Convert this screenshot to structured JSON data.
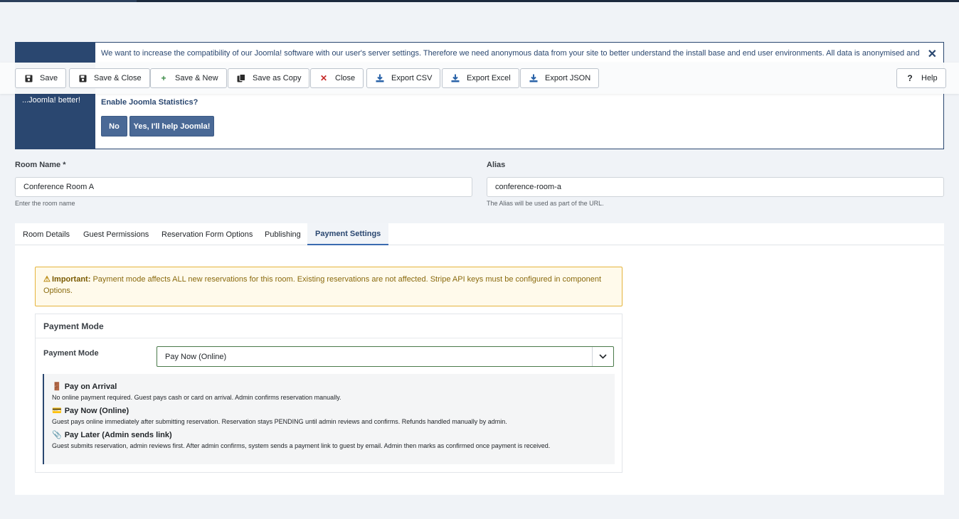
{
  "stats": {
    "side_text": "...Joomla! better!",
    "message": "We want to increase the compatibility of our Joomla! software with our user's server settings. Therefore we need anonymous data from your site to better understand the install base and end user environments. All data is anonymised and only",
    "question": "Enable Joomla Statistics?",
    "no_label": "No",
    "yes_label": "Yes, I'll help Joomla!"
  },
  "toolbar": {
    "save": "Save",
    "save_close": "Save & Close",
    "save_new": "Save & New",
    "save_copy": "Save as Copy",
    "close": "Close",
    "export_csv": "Export CSV",
    "export_excel": "Export Excel",
    "export_json": "Export JSON",
    "help": "Help"
  },
  "form": {
    "room_name_label": "Room Name *",
    "room_name_value": "Conference Room A",
    "room_name_help": "Enter the room name",
    "alias_label": "Alias",
    "alias_value": "conference-room-a",
    "alias_help": "The Alias will be used as part of the URL."
  },
  "tabs": [
    {
      "label": "Room Details"
    },
    {
      "label": "Guest Permissions"
    },
    {
      "label": "Reservation Form Options"
    },
    {
      "label": "Publishing"
    },
    {
      "label": "Payment Settings"
    }
  ],
  "alert": {
    "strong": "Important:",
    "text": "Payment mode affects ALL new reservations for this room. Existing reservations are not affected. Stripe API keys must be configured in component Options."
  },
  "payment": {
    "card_title": "Payment Mode",
    "field_label": "Payment Mode",
    "selected": "Pay Now (Online)",
    "options": [
      {
        "icon": "🚪",
        "title": "Pay on Arrival",
        "desc": "No online payment required. Guest pays cash or card on arrival. Admin confirms reservation manually."
      },
      {
        "icon": "💳",
        "title": "Pay Now (Online)",
        "desc": "Guest pays online immediately after submitting reservation. Reservation stays PENDING until admin reviews and confirms. Refunds handled manually by admin."
      },
      {
        "icon": "📎",
        "title": "Pay Later (Admin sends link)",
        "desc": "Guest submits reservation, admin reviews first. After admin confirms, system sends a payment link to guest by email. Admin then marks as confirmed once payment is received."
      }
    ]
  }
}
